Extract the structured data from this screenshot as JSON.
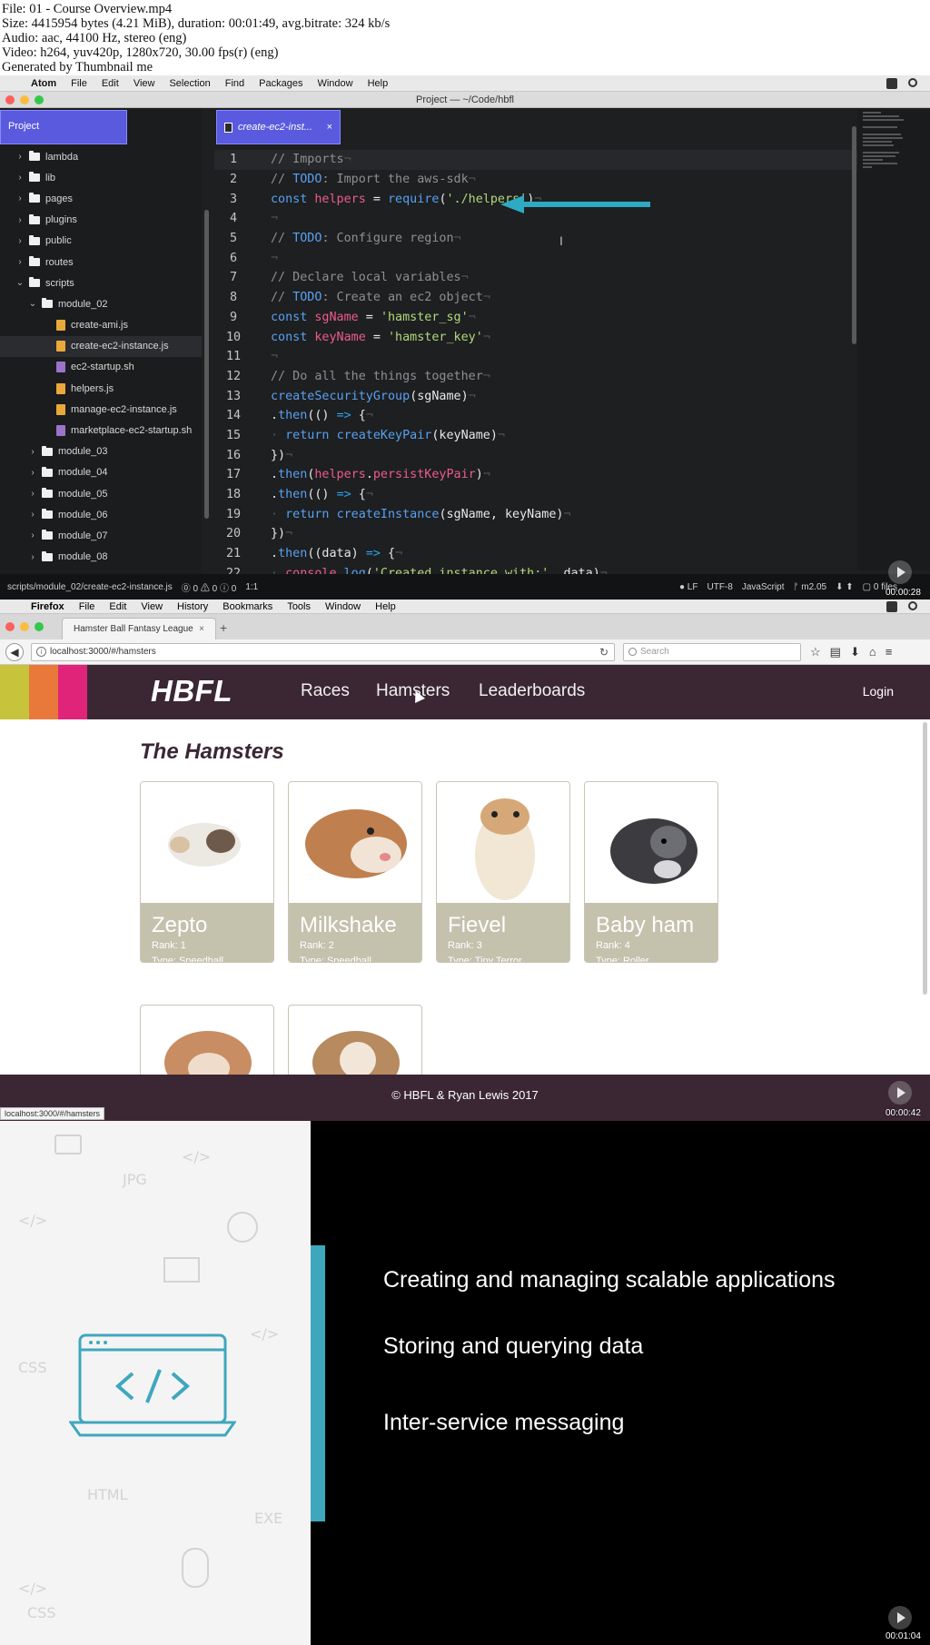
{
  "meta": {
    "lines": [
      "File: 01 - Course Overview.mp4",
      "Size: 4415954 bytes (4.21 MiB), duration: 00:01:49, avg.bitrate: 324 kb/s",
      "Audio: aac, 44100 Hz, stereo (eng)",
      "Video: h264, yuv420p, 1280x720, 30.00 fps(r) (eng)",
      "Generated by Thumbnail me"
    ]
  },
  "atom": {
    "menu": [
      "Atom",
      "File",
      "Edit",
      "View",
      "Selection",
      "Find",
      "Packages",
      "Window",
      "Help"
    ],
    "window_title": "Project — ~/Code/hbfl",
    "tree_title": "Project",
    "tab_label": "create-ec2-inst...",
    "tab_close": "×",
    "tree": [
      {
        "label": "lambda",
        "type": "folder",
        "indent": 0,
        "open": false
      },
      {
        "label": "lib",
        "type": "folder",
        "indent": 0,
        "open": false
      },
      {
        "label": "pages",
        "type": "folder",
        "indent": 0,
        "open": false
      },
      {
        "label": "plugins",
        "type": "folder",
        "indent": 0,
        "open": false
      },
      {
        "label": "public",
        "type": "folder",
        "indent": 0,
        "open": false
      },
      {
        "label": "routes",
        "type": "folder",
        "indent": 0,
        "open": false
      },
      {
        "label": "scripts",
        "type": "folder",
        "indent": 0,
        "open": true
      },
      {
        "label": "module_02",
        "type": "folder",
        "indent": 1,
        "open": true
      },
      {
        "label": "create-ami.js",
        "type": "js",
        "indent": 2
      },
      {
        "label": "create-ec2-instance.js",
        "type": "js",
        "indent": 2,
        "selected": true
      },
      {
        "label": "ec2-startup.sh",
        "type": "sh",
        "indent": 2
      },
      {
        "label": "helpers.js",
        "type": "js",
        "indent": 2
      },
      {
        "label": "manage-ec2-instance.js",
        "type": "js",
        "indent": 2
      },
      {
        "label": "marketplace-ec2-startup.sh",
        "type": "sh",
        "indent": 2
      },
      {
        "label": "module_03",
        "type": "folder",
        "indent": 1,
        "open": false
      },
      {
        "label": "module_04",
        "type": "folder",
        "indent": 1,
        "open": false
      },
      {
        "label": "module_05",
        "type": "folder",
        "indent": 1,
        "open": false
      },
      {
        "label": "module_06",
        "type": "folder",
        "indent": 1,
        "open": false
      },
      {
        "label": "module_07",
        "type": "folder",
        "indent": 1,
        "open": false
      },
      {
        "label": "module_08",
        "type": "folder",
        "indent": 1,
        "open": false
      }
    ],
    "code": [
      [
        [
          "c-cm",
          "// Imports"
        ],
        [
          "c-ws",
          "¬"
        ]
      ],
      [
        [
          "c-cm",
          "// "
        ],
        [
          "c-kw",
          "TODO"
        ],
        [
          "c-cm",
          ": Import the aws-sdk"
        ],
        [
          "c-ws",
          "¬"
        ]
      ],
      [
        [
          "c-kw",
          "const "
        ],
        [
          "c-id",
          "helpers"
        ],
        [
          "c-pl",
          " = "
        ],
        [
          "c-fn",
          "require"
        ],
        [
          "c-pl",
          "("
        ],
        [
          "c-st",
          "'./helpers'"
        ],
        [
          "c-pl",
          ")"
        ],
        [
          "c-ws",
          "¬"
        ]
      ],
      [
        [
          "c-ws",
          "¬"
        ]
      ],
      [
        [
          "c-cm",
          "// "
        ],
        [
          "c-kw",
          "TODO"
        ],
        [
          "c-cm",
          ": Configure region"
        ],
        [
          "c-ws",
          "¬"
        ]
      ],
      [
        [
          "c-ws",
          "¬"
        ]
      ],
      [
        [
          "c-cm",
          "// Declare local variables"
        ],
        [
          "c-ws",
          "¬"
        ]
      ],
      [
        [
          "c-cm",
          "// "
        ],
        [
          "c-kw",
          "TODO"
        ],
        [
          "c-cm",
          ": Create an ec2 object"
        ],
        [
          "c-ws",
          "¬"
        ]
      ],
      [
        [
          "c-kw",
          "const "
        ],
        [
          "c-id",
          "sgName"
        ],
        [
          "c-pl",
          " = "
        ],
        [
          "c-st",
          "'hamster_sg'"
        ],
        [
          "c-ws",
          "¬"
        ]
      ],
      [
        [
          "c-kw",
          "const "
        ],
        [
          "c-id",
          "keyName"
        ],
        [
          "c-pl",
          " = "
        ],
        [
          "c-st",
          "'hamster_key'"
        ],
        [
          "c-ws",
          "¬"
        ]
      ],
      [
        [
          "c-ws",
          "¬"
        ]
      ],
      [
        [
          "c-cm",
          "// Do all the things together"
        ],
        [
          "c-ws",
          "¬"
        ]
      ],
      [
        [
          "c-fn",
          "createSecurityGroup"
        ],
        [
          "c-pl",
          "(sgName)"
        ],
        [
          "c-ws",
          "¬"
        ]
      ],
      [
        [
          "c-pl",
          "."
        ],
        [
          "c-fn",
          "then"
        ],
        [
          "c-pl",
          "(() "
        ],
        [
          "c-ar",
          "=>"
        ],
        [
          "c-pl",
          " {"
        ],
        [
          "c-ws",
          "¬"
        ]
      ],
      [
        [
          "c-ws",
          "· "
        ],
        [
          "c-kw",
          "return "
        ],
        [
          "c-fn",
          "createKeyPair"
        ],
        [
          "c-pl",
          "(keyName)"
        ],
        [
          "c-ws",
          "¬"
        ]
      ],
      [
        [
          "c-pl",
          "})"
        ],
        [
          "c-ws",
          "¬"
        ]
      ],
      [
        [
          "c-pl",
          "."
        ],
        [
          "c-fn",
          "then"
        ],
        [
          "c-pl",
          "("
        ],
        [
          "c-id",
          "helpers"
        ],
        [
          "c-pl",
          "."
        ],
        [
          "c-id",
          "persistKeyPair"
        ],
        [
          "c-pl",
          ")"
        ],
        [
          "c-ws",
          "¬"
        ]
      ],
      [
        [
          "c-pl",
          "."
        ],
        [
          "c-fn",
          "then"
        ],
        [
          "c-pl",
          "(() "
        ],
        [
          "c-ar",
          "=>"
        ],
        [
          "c-pl",
          " {"
        ],
        [
          "c-ws",
          "¬"
        ]
      ],
      [
        [
          "c-ws",
          "· "
        ],
        [
          "c-kw",
          "return "
        ],
        [
          "c-fn",
          "createInstance"
        ],
        [
          "c-pl",
          "(sgName, keyName)"
        ],
        [
          "c-ws",
          "¬"
        ]
      ],
      [
        [
          "c-pl",
          "})"
        ],
        [
          "c-ws",
          "¬"
        ]
      ],
      [
        [
          "c-pl",
          "."
        ],
        [
          "c-fn",
          "then"
        ],
        [
          "c-pl",
          "((data) "
        ],
        [
          "c-ar",
          "=>"
        ],
        [
          "c-pl",
          " {"
        ],
        [
          "c-ws",
          "¬"
        ]
      ],
      [
        [
          "c-ws",
          "· "
        ],
        [
          "c-id",
          "console"
        ],
        [
          "c-pl",
          "."
        ],
        [
          "c-fn",
          "log"
        ],
        [
          "c-pl",
          "("
        ],
        [
          "c-st",
          "'Created instance with:'"
        ],
        [
          "c-pl",
          ", data)"
        ],
        [
          "c-ws",
          "¬"
        ]
      ]
    ],
    "status_left": [
      "scripts/module_02/create-ec2-instance.js",
      "⓪ 0 ⚠ 0 ⓘ 0",
      "1:1"
    ],
    "status_right": [
      "● LF",
      "UTF-8",
      "JavaScript",
      "ᚠ m2.05",
      "⬇ ⬆",
      "▢ 0 files"
    ],
    "timestamp": "00:00:28"
  },
  "firefox": {
    "menu": [
      "Firefox",
      "File",
      "Edit",
      "View",
      "History",
      "Bookmarks",
      "Tools",
      "Window",
      "Help"
    ],
    "tab_title": "Hamster Ball Fantasy League",
    "tab_close": "×",
    "new_tab": "+",
    "url": "localhost:3000/#/hamsters",
    "search_placeholder": "Search",
    "site": {
      "brand": "HBFL",
      "nav": [
        "Races",
        "Hamsters",
        "Leaderboards"
      ],
      "login": "Login",
      "heading": "The Hamsters",
      "stripe_colors": [
        "#c7c33a",
        "#e8793a",
        "#e0247a"
      ],
      "hamsters": [
        {
          "name": "Zepto",
          "rank": "Rank: 1",
          "type": "Type: Speedball"
        },
        {
          "name": "Milkshake",
          "rank": "Rank: 2",
          "type": "Type: Speedball"
        },
        {
          "name": "Fievel",
          "rank": "Rank: 3",
          "type": "Type: Tiny Terror"
        },
        {
          "name": "Baby ham",
          "rank": "Rank: 4",
          "type": "Type: Roller"
        }
      ],
      "footer": "© HBFL & Ryan Lewis 2017"
    },
    "status_link": "localhost:3000/#/hamsters",
    "timestamp": "00:00:42"
  },
  "slide": {
    "bullets": [
      "Creating and managing scalable applications",
      "Storing and querying data",
      "Inter-service messaging"
    ],
    "doodles": [
      "JPG",
      "CSS",
      "HTML",
      "EXE",
      "CSS",
      "</>",
      "</>",
      "</>",
      "</>"
    ],
    "timestamp": "00:01:04"
  }
}
